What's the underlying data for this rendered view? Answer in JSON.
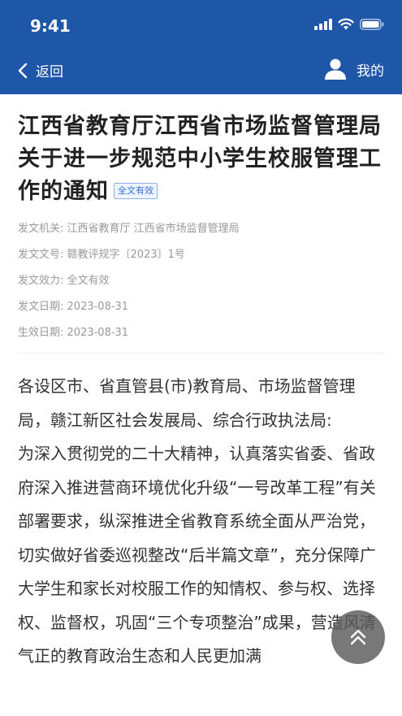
{
  "status_bar": {
    "time": "9:41"
  },
  "nav": {
    "back_label": "返回",
    "mine_label": "我的"
  },
  "article": {
    "title": "江西省教育厅江西省市场监督管理局关于进一步规范中小学生校服管理工作的通知",
    "badge": "全文有效",
    "meta": [
      {
        "label": "发文机关:",
        "value": "江西省教育厅 江西省市场监督管理局"
      },
      {
        "label": "发文文号:",
        "value": "赣教评规字〔2023〕1号"
      },
      {
        "label": "发文效力:",
        "value": "全文有效"
      },
      {
        "label": "发文日期:",
        "value": "2023-08-31"
      },
      {
        "label": "生效日期:",
        "value": "2023-08-31"
      }
    ],
    "paragraphs": [
      "各设区市、省直管县(市)教育局、市场监督管理局，赣江新区社会发展局、综合行政执法局:",
      "为深入贯彻党的二十大精神，认真落实省委、省政府深入推进营商环境优化升级“一号改革工程”有关部署要求，纵深推进全省教育系统全面从严治党，切实做好省委巡视整改“后半篇文章”，充分保障广大学生和家长对校服工作的知情权、参与权、选择权、监督权，巩固“三个专项整治”成果，营造风清气正的教育政治生态和人民更加满"
    ]
  },
  "colors": {
    "header_bg": "#1e56a8",
    "badge_color": "#2f6fd1"
  },
  "icons": {
    "signal": "cellular-signal-icon",
    "wifi": "wifi-icon",
    "battery": "battery-icon",
    "back": "chevron-left-icon",
    "user": "user-icon",
    "scroll_top": "double-chevron-up-icon"
  }
}
